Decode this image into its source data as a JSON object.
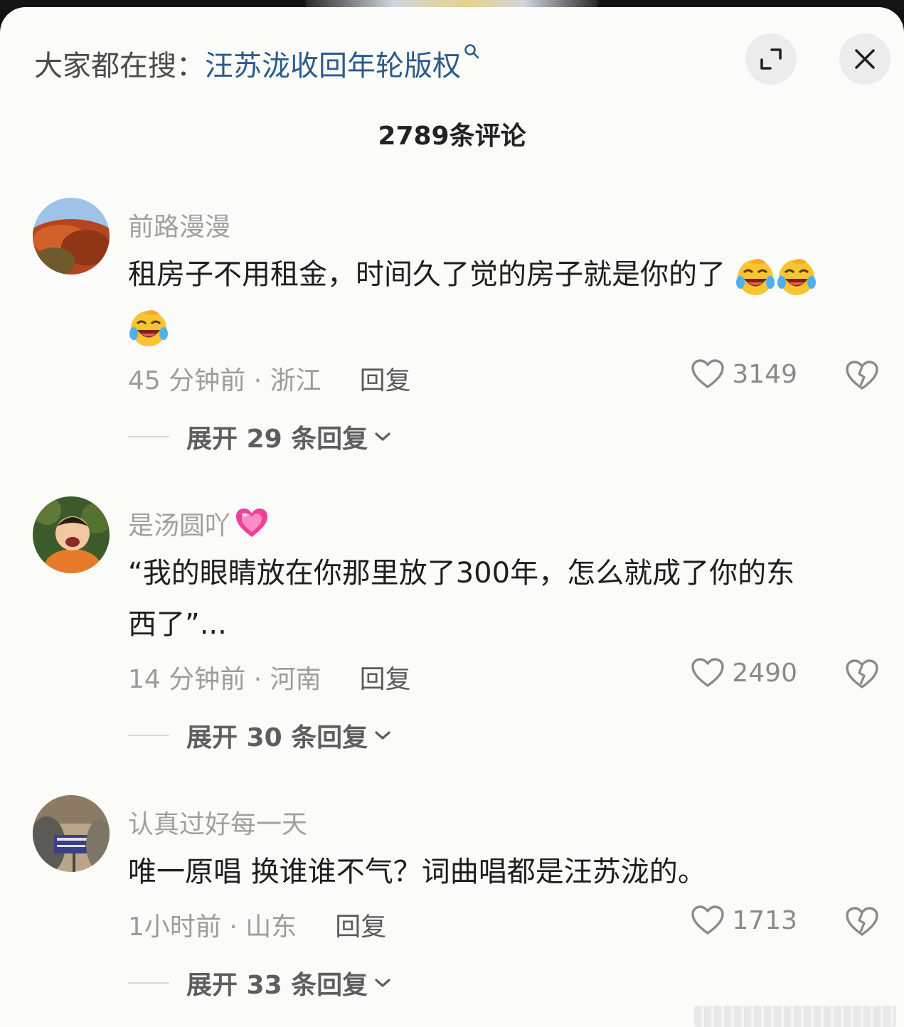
{
  "header": {
    "search_prefix": "大家都在搜：",
    "search_term": "汪苏泷收回年轮版权",
    "expand_icon": "expand-icon",
    "close_icon": "close-icon"
  },
  "comment_count": "2789条评论",
  "comments": [
    {
      "username": "前路漫漫",
      "text": "租房子不用租金，时间久了觉的房子就是你的了",
      "emojis": [
        "laughing-cry-emoji",
        "laughing-cry-emoji",
        "laughing-cry-emoji"
      ],
      "time_location": "45 分钟前 · 浙江",
      "reply_label": "回复",
      "likes": "3149",
      "expand_label": "展开 29 条回复"
    },
    {
      "username": "是汤圆吖",
      "username_emoji": "pink-heart-emoji",
      "text_line1": "“我的眼睛放在你那里放了300年，怎么就成了你的东",
      "text_line2": "西了”...",
      "time_location": "14 分钟前 · 河南",
      "reply_label": "回复",
      "likes": "2490",
      "expand_label": "展开 30 条回复"
    },
    {
      "username": "认真过好每一天",
      "text": "唯一原唱 换谁谁不气？词曲唱都是汪苏泷的。",
      "time_location": "1小时前 · 山东",
      "reply_label": "回复",
      "likes": "1713",
      "expand_label": "展开 33 条回复"
    }
  ],
  "colors": {
    "search_term": "#2b5c8a",
    "background": "#fbfbfa",
    "meta_text": "#9c9c9c"
  }
}
